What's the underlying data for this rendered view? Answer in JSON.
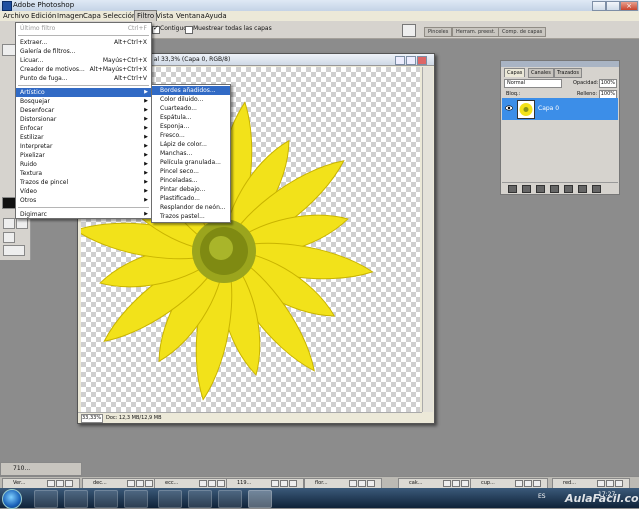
{
  "app": {
    "title": "Adobe Photoshop"
  },
  "menubar": [
    "Archivo",
    "Edición",
    "Imagen",
    "Capa",
    "Selección",
    "Filtro",
    "Vista",
    "Ventana",
    "Ayuda"
  ],
  "options": {
    "contiguous_label": "Contiguo",
    "sample_all_label": "Muestrear todas las capas"
  },
  "palette_well": [
    "Pinceles",
    "Herram. preest.",
    "Comp. de capas"
  ],
  "document": {
    "title": "g al 33,3% (Capa 0, RGB/8)",
    "zoom": "33,33%",
    "doc_info": "Doc: 12,3 MB/12,9 MB"
  },
  "filter_menu": {
    "items": [
      {
        "label": "Último filtro",
        "shortcut": "Ctrl+F",
        "disabled": true
      },
      {
        "sep": true
      },
      {
        "label": "Extraer...",
        "shortcut": "Alt+Ctrl+X"
      },
      {
        "label": "Galería de filtros..."
      },
      {
        "label": "Licuar...",
        "shortcut": "Mayús+Ctrl+X"
      },
      {
        "label": "Creador de motivos...",
        "shortcut": "Alt+Mayús+Ctrl+X"
      },
      {
        "label": "Punto de fuga...",
        "shortcut": "Alt+Ctrl+V"
      },
      {
        "sep": true
      },
      {
        "label": "Artístico",
        "submenu": true,
        "highlighted": true
      },
      {
        "label": "Bosquejar",
        "submenu": true
      },
      {
        "label": "Desenfocar",
        "submenu": true
      },
      {
        "label": "Distorsionar",
        "submenu": true
      },
      {
        "label": "Enfocar",
        "submenu": true
      },
      {
        "label": "Estilizar",
        "submenu": true
      },
      {
        "label": "Interpretar",
        "submenu": true
      },
      {
        "label": "Pixelizar",
        "submenu": true
      },
      {
        "label": "Ruido",
        "submenu": true
      },
      {
        "label": "Textura",
        "submenu": true
      },
      {
        "label": "Trazos de pincel",
        "submenu": true
      },
      {
        "label": "Vídeo",
        "submenu": true
      },
      {
        "label": "Otros",
        "submenu": true
      },
      {
        "sep": true
      },
      {
        "label": "Digimarc",
        "submenu": true
      }
    ]
  },
  "artistic_submenu": {
    "items": [
      {
        "label": "Bordes añadidos...",
        "highlighted": true
      },
      {
        "label": "Color diluido..."
      },
      {
        "label": "Cuarteado..."
      },
      {
        "label": "Espátula..."
      },
      {
        "label": "Esponja..."
      },
      {
        "label": "Fresco..."
      },
      {
        "label": "Lápiz de color..."
      },
      {
        "label": "Manchas..."
      },
      {
        "label": "Película granulada..."
      },
      {
        "label": "Pincel seco..."
      },
      {
        "label": "Pinceladas..."
      },
      {
        "label": "Pintar debajo..."
      },
      {
        "label": "Plastificado..."
      },
      {
        "label": "Resplandor de neón..."
      },
      {
        "label": "Trazos pastel..."
      }
    ]
  },
  "layers_panel": {
    "tabs": [
      "Capas",
      "Canales",
      "Trazados"
    ],
    "blend_mode": "Normal",
    "opacity_label": "Opacidad:",
    "opacity_value": "100%",
    "lock_label": "Bloq.:",
    "fill_label": "Relleno:",
    "fill_value": "100%",
    "layer_name": "Capa 0"
  },
  "minimized_doc": {
    "label": "710..."
  },
  "taskstrip": [
    "Ver...",
    "dec...",
    "ecc...",
    "119...",
    "flor...",
    "cak...",
    "cup...",
    "red..."
  ],
  "taskbar": {
    "language": "ES",
    "time": "17:27"
  },
  "watermark": "AulaFacil.com",
  "colors": {
    "highlight": "#316ac5",
    "layer_selected": "#3c8ee8",
    "flower_petal": "#f2e21a",
    "flower_center": "#9ba51d"
  }
}
